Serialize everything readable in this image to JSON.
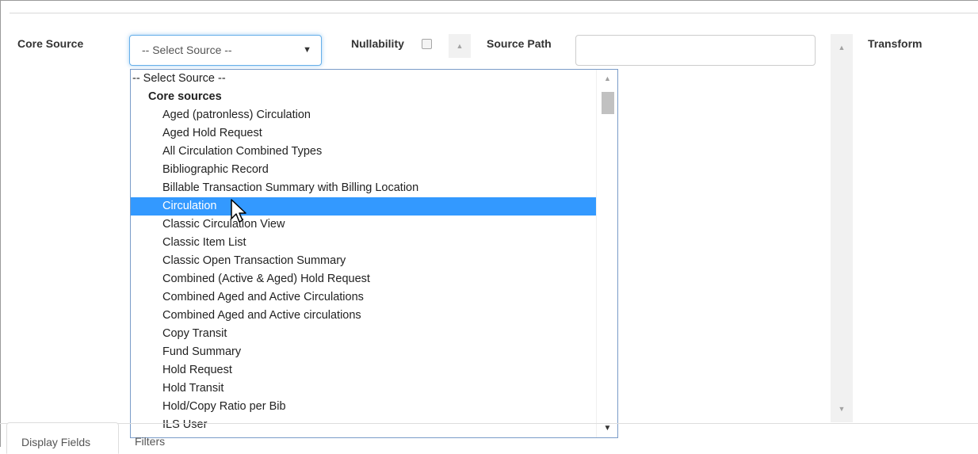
{
  "fields": {
    "core_source_label": "Core Source",
    "nullability_label": "Nullability",
    "source_path_label": "Source Path",
    "transform_label": "Transform",
    "select_value": "-- Select Source --",
    "source_path_value": ""
  },
  "dropdown": {
    "placeholder": "-- Select Source --",
    "group_label": "Core sources",
    "items": [
      "Aged (patronless) Circulation",
      "Aged Hold Request",
      "All Circulation Combined Types",
      "Bibliographic Record",
      "Billable Transaction Summary with Billing Location",
      "Circulation",
      "Classic Circulation View",
      "Classic Item List",
      "Classic Open Transaction Summary",
      "Combined (Active & Aged) Hold Request",
      "Combined Aged and Active Circulations",
      "Combined Aged and Active circulations",
      "Copy Transit",
      "Fund Summary",
      "Hold Request",
      "Hold Transit",
      "Hold/Copy Ratio per Bib",
      "ILS User"
    ],
    "highlighted": "Circulation"
  },
  "tabs": {
    "display_fields": "Display Fields",
    "filters": "Filters"
  },
  "icons": {
    "select_arrow": "triangle-down-icon",
    "scroll_up": "triangle-up-icon",
    "scroll_down": "triangle-down-icon",
    "pointer": "mouse-pointer-icon"
  },
  "colors": {
    "highlight": "#3399ff",
    "focus_border": "#66afe9"
  }
}
